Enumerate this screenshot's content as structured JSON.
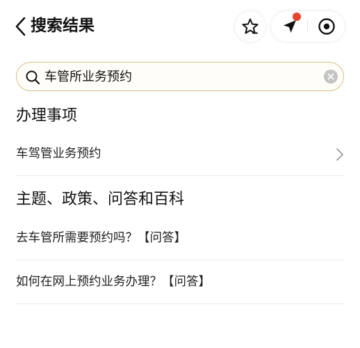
{
  "header": {
    "title": "搜索结果"
  },
  "search": {
    "query": "车管所业务预约"
  },
  "sections": [
    {
      "title": "办理事项",
      "items": [
        {
          "label": "车驾管业务预约"
        }
      ]
    },
    {
      "title": "主题、政策、问答和百科",
      "items": [
        {
          "label": "去车管所需要预约吗？【问答】"
        },
        {
          "label": "如何在网上预约业务办理？【问答】"
        }
      ]
    }
  ],
  "colors": {
    "search_border": "#d4bf84",
    "notification_dot": "#e8452f",
    "divider": "#ececec"
  },
  "icons": {
    "back": "chevron-left-icon",
    "favorite": "star-icon",
    "location": "navigation-arrow-icon",
    "close": "target-circle-icon",
    "search": "search-icon",
    "clear": "clear-x-icon",
    "row_arrow": "chevron-right-icon"
  }
}
